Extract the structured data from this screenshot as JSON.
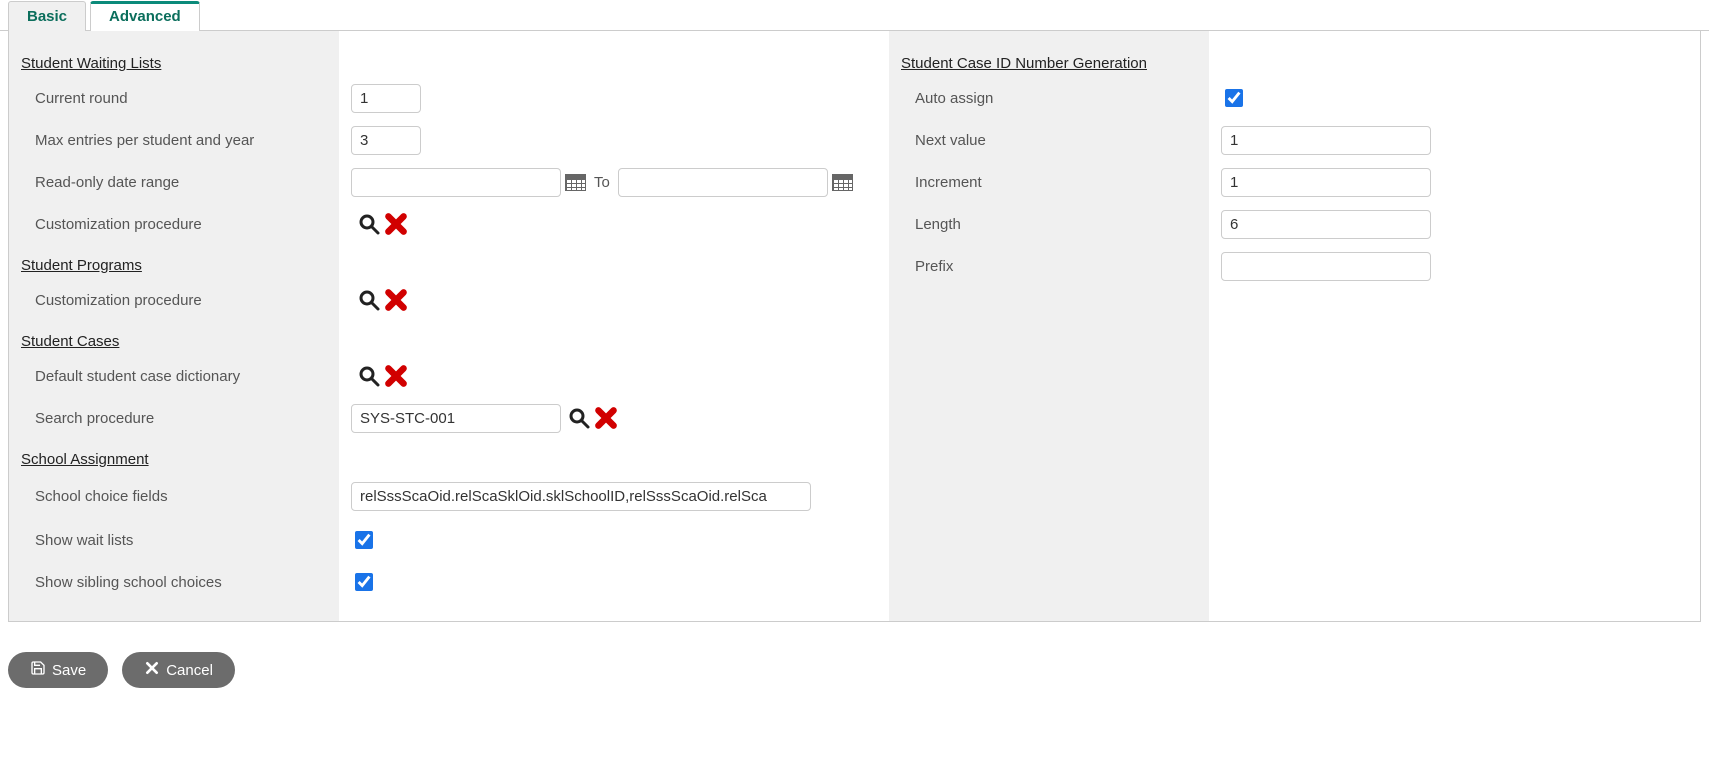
{
  "tabs": {
    "basic": "Basic",
    "advanced": "Advanced"
  },
  "left": {
    "sections": {
      "waiting": "Student Waiting Lists",
      "programs": "Student Programs",
      "cases": "Student Cases",
      "school": "School Assignment"
    },
    "labels": {
      "current_round": "Current round",
      "max_entries": "Max entries per student and year",
      "readonly_range": "Read-only date range",
      "cust_proc_wait": "Customization procedure",
      "cust_proc_prog": "Customization procedure",
      "default_case_dict": "Default student case dictionary",
      "search_proc": "Search procedure",
      "school_choice": "School choice fields",
      "show_wait": "Show wait lists",
      "show_sibling": "Show sibling school choices",
      "to": "To"
    },
    "values": {
      "current_round": "1",
      "max_entries": "3",
      "date_from": "",
      "date_to": "",
      "search_proc": "SYS-STC-001",
      "school_choice": "relSssScaOid.relScaSklOid.sklSchoolID,relSssScaOid.relSca",
      "show_wait": true,
      "show_sibling": true
    }
  },
  "right": {
    "section": "Student Case ID Number Generation",
    "labels": {
      "auto_assign": "Auto assign",
      "next_value": "Next value",
      "increment": "Increment",
      "length": "Length",
      "prefix": "Prefix"
    },
    "values": {
      "auto_assign": true,
      "next_value": "1",
      "increment": "1",
      "length": "6",
      "prefix": ""
    }
  },
  "buttons": {
    "save": "Save",
    "cancel": "Cancel"
  }
}
